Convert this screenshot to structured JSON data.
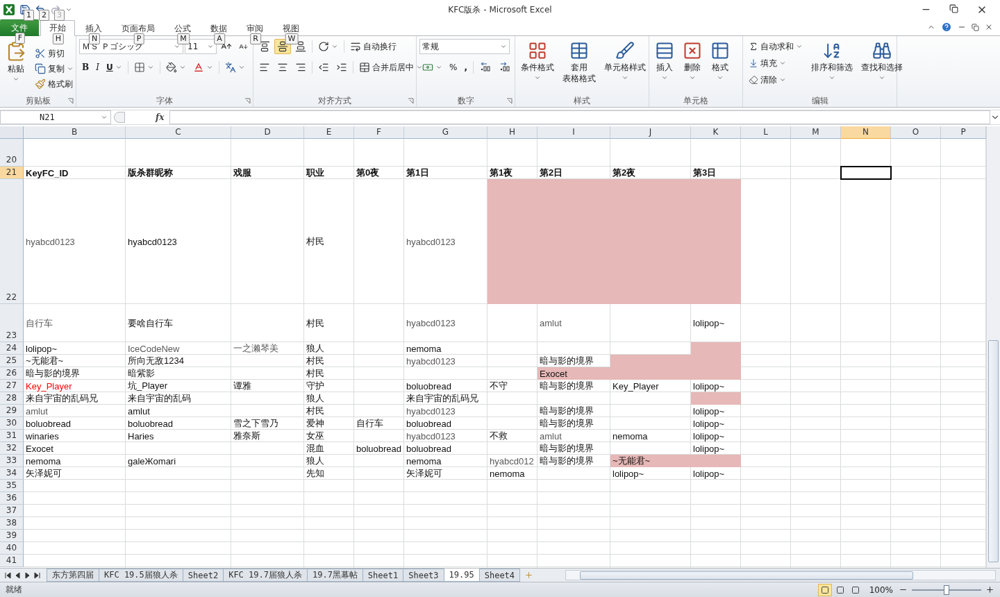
{
  "window": {
    "title": "KFC版杀 - Microsoft Excel"
  },
  "quick_access": [
    {
      "keytip": "1",
      "disabled": false
    },
    {
      "keytip": "2",
      "disabled": false
    },
    {
      "keytip": "3",
      "disabled": true
    }
  ],
  "tabs": [
    {
      "label": "文件",
      "keytip": "F",
      "kind": "file",
      "selected": false
    },
    {
      "label": "开始",
      "keytip": "H",
      "kind": "tab",
      "selected": true
    },
    {
      "label": "插入",
      "keytip": "N",
      "kind": "tab",
      "selected": false
    },
    {
      "label": "页面布局",
      "keytip": "P",
      "kind": "tab",
      "selected": false
    },
    {
      "label": "公式",
      "keytip": "M",
      "kind": "tab",
      "selected": false
    },
    {
      "label": "数据",
      "keytip": "A",
      "kind": "tab",
      "selected": false
    },
    {
      "label": "审阅",
      "keytip": "R",
      "kind": "tab",
      "selected": false
    },
    {
      "label": "视图",
      "keytip": "W",
      "kind": "tab",
      "selected": false
    }
  ],
  "ribbon": {
    "clipboard": {
      "label": "剪贴板",
      "paste": "粘贴",
      "cut": "剪切",
      "copy": "复制",
      "format_painter": "格式刷"
    },
    "font": {
      "label": "字体",
      "font_name": "ＭＳ Ｐゴシック",
      "font_size": "11",
      "bold": "B",
      "italic": "I",
      "underline": "U"
    },
    "alignment": {
      "label": "对齐方式",
      "vertical": [
        {
          "selected": false
        },
        {
          "selected": true
        },
        {
          "selected": false
        }
      ],
      "wrap_text": "自动换行",
      "merge_center": "合并后居中"
    },
    "number": {
      "label": "数字",
      "format": "常规",
      "percent": "%",
      "comma": ","
    },
    "styles": {
      "label": "样式",
      "conditional": "条件格式",
      "table_format": [
        "套用",
        "表格格式"
      ],
      "cell_styles": "单元格样式"
    },
    "cells": {
      "label": "单元格",
      "insert": "插入",
      "delete": "删除",
      "format": "格式"
    },
    "editing": {
      "label": "编辑",
      "autosum": "自动求和",
      "fill": "填充",
      "clear": "清除",
      "sort": "排序和筛选",
      "find": "查找和选择"
    }
  },
  "formula_bar": {
    "name_box": "N21",
    "fx": "fx"
  },
  "columns": [
    {
      "label": "B",
      "selected": false
    },
    {
      "label": "C",
      "selected": false
    },
    {
      "label": "D",
      "selected": false
    },
    {
      "label": "E",
      "selected": false
    },
    {
      "label": "F",
      "selected": false
    },
    {
      "label": "G",
      "selected": false
    },
    {
      "label": "H",
      "selected": false
    },
    {
      "label": "I",
      "selected": false
    },
    {
      "label": "J",
      "selected": false
    },
    {
      "label": "K",
      "selected": false
    },
    {
      "label": "L",
      "selected": false
    },
    {
      "label": "M",
      "selected": false
    },
    {
      "label": "N",
      "selected": true
    },
    {
      "label": "O",
      "selected": false
    },
    {
      "label": "P",
      "selected": false
    }
  ],
  "rows": [
    {
      "label": "20",
      "selected": false,
      "kind": "partial"
    },
    {
      "label": "21",
      "selected": true,
      "kind": "header",
      "cells": [
        {
          "text": "KeyFC_ID"
        },
        {
          "text": "版杀群昵称"
        },
        {
          "text": "戏服"
        },
        {
          "text": "职业"
        },
        {
          "text": "第0夜"
        },
        {
          "text": "第1日"
        },
        {
          "text": "第1夜"
        },
        {
          "text": "第2日"
        },
        {
          "text": "第2夜"
        },
        {
          "text": "第3日"
        }
      ]
    },
    {
      "label": "22",
      "selected": false,
      "kind": "tall",
      "cells": [
        {
          "text": "hyabcd0123",
          "color": "#595959"
        },
        {
          "text": "hyabcd0123"
        },
        null,
        {
          "text": "村民"
        },
        null,
        {
          "text": "hyabcd0123",
          "color": "#595959"
        },
        {
          "fill": true
        },
        {
          "fill": true
        },
        {
          "fill": true
        },
        {
          "fill": true
        }
      ]
    },
    {
      "label": "23",
      "selected": false,
      "kind": "medium",
      "cells": [
        {
          "text": "自行车",
          "color": "#595959"
        },
        {
          "text": "要啥自行车"
        },
        null,
        {
          "text": "村民"
        },
        null,
        {
          "text": "hyabcd0123",
          "color": "#595959"
        },
        null,
        {
          "text": "amlut",
          "color": "#595959"
        },
        null,
        {
          "text": "lolipop~"
        }
      ]
    },
    {
      "label": "24",
      "selected": false,
      "kind": "normal",
      "cells": [
        {
          "text": "lolipop~"
        },
        {
          "text": "IceCodeNew",
          "color": "#595959"
        },
        {
          "text": "一之濑琴美",
          "color": "#595959"
        },
        {
          "text": "狼人"
        },
        null,
        {
          "text": "nemoma"
        },
        null,
        null,
        null,
        {
          "fill": true
        }
      ]
    },
    {
      "label": "25",
      "selected": false,
      "kind": "normal",
      "cells": [
        {
          "text": "~无能君~"
        },
        {
          "text": "所向无敌1234"
        },
        null,
        {
          "text": "村民"
        },
        null,
        {
          "text": "hyabcd0123",
          "color": "#595959"
        },
        null,
        {
          "text": "暗与影的境界"
        },
        {
          "fill": true
        },
        {
          "fill": true
        }
      ]
    },
    {
      "label": "26",
      "selected": false,
      "kind": "normal",
      "cells": [
        {
          "text": "暗与影的境界"
        },
        {
          "text": "暗紫影"
        },
        null,
        {
          "text": "村民"
        },
        null,
        null,
        null,
        {
          "text": "Exocet",
          "fill": true
        },
        {
          "fill": true
        },
        {
          "fill": true
        }
      ]
    },
    {
      "label": "27",
      "selected": false,
      "kind": "normal",
      "cells": [
        {
          "text": "Key_Player",
          "color": "#ff0000"
        },
        {
          "text": "坑_Player"
        },
        {
          "text": "谭雅"
        },
        {
          "text": "守护"
        },
        null,
        {
          "text": "boluobread"
        },
        {
          "text": "不守"
        },
        {
          "text": "暗与影的境界"
        },
        {
          "text": "Key_Player"
        },
        {
          "text": "lolipop~"
        }
      ]
    },
    {
      "label": "28",
      "selected": false,
      "kind": "normal",
      "cells": [
        {
          "text": "来自宇宙的乱码兄"
        },
        {
          "text": "来自宇宙的乱码"
        },
        null,
        {
          "text": "狼人"
        },
        null,
        {
          "text": "来自宇宙的乱码兄"
        },
        null,
        null,
        null,
        {
          "fill": true
        }
      ]
    },
    {
      "label": "29",
      "selected": false,
      "kind": "normal",
      "cells": [
        {
          "text": "amlut",
          "color": "#595959"
        },
        {
          "text": "amlut"
        },
        null,
        {
          "text": "村民"
        },
        null,
        {
          "text": "hyabcd0123",
          "color": "#595959"
        },
        null,
        {
          "text": "暗与影的境界"
        },
        null,
        {
          "text": "lolipop~"
        }
      ]
    },
    {
      "label": "30",
      "selected": false,
      "kind": "normal",
      "cells": [
        {
          "text": "boluobread"
        },
        {
          "text": "boluobread"
        },
        {
          "text": "雪之下雪乃"
        },
        {
          "text": "爱神"
        },
        {
          "text": "自行车"
        },
        {
          "text": "boluobread"
        },
        null,
        {
          "text": "暗与影的境界"
        },
        null,
        {
          "text": "lolipop~"
        }
      ]
    },
    {
      "label": "31",
      "selected": false,
      "kind": "normal",
      "cells": [
        {
          "text": "winaries"
        },
        {
          "text": "Haries"
        },
        {
          "text": "雅奈斯"
        },
        {
          "text": "女巫"
        },
        null,
        {
          "text": "hyabcd0123",
          "color": "#595959"
        },
        {
          "text": "不救"
        },
        {
          "text": "amlut",
          "color": "#595959"
        },
        {
          "text": "nemoma"
        },
        {
          "text": "lolipop~"
        }
      ]
    },
    {
      "label": "32",
      "selected": false,
      "kind": "normal",
      "cells": [
        {
          "text": "Exocet"
        },
        null,
        null,
        {
          "text": "混血"
        },
        {
          "text": "boluobread"
        },
        {
          "text": "boluobread"
        },
        null,
        {
          "text": "暗与影的境界"
        },
        null,
        {
          "text": "lolipop~"
        }
      ]
    },
    {
      "label": "33",
      "selected": false,
      "kind": "normal",
      "cells": [
        {
          "text": "nemoma"
        },
        {
          "text": "galeЖomari"
        },
        null,
        {
          "text": "狼人"
        },
        null,
        {
          "text": "nemoma"
        },
        {
          "text": "hyabcd012",
          "color": "#595959"
        },
        {
          "text": "暗与影的境界"
        },
        {
          "text": "~无能君~",
          "fill": true
        },
        {
          "fill": true
        }
      ]
    },
    {
      "label": "34",
      "selected": false,
      "kind": "normal",
      "cells": [
        {
          "text": "矢泽妮可"
        },
        null,
        null,
        {
          "text": "先知"
        },
        null,
        {
          "text": "矢泽妮可"
        },
        {
          "text": "nemoma"
        },
        null,
        {
          "text": "lolipop~"
        },
        {
          "text": "lolipop~"
        }
      ]
    },
    {
      "label": "35",
      "selected": false,
      "kind": "normal"
    },
    {
      "label": "36",
      "selected": false,
      "kind": "normal"
    },
    {
      "label": "37",
      "selected": false,
      "kind": "normal"
    },
    {
      "label": "38",
      "selected": false,
      "kind": "normal"
    },
    {
      "label": "39",
      "selected": false,
      "kind": "normal"
    },
    {
      "label": "40",
      "selected": false,
      "kind": "normal"
    },
    {
      "label": "41",
      "selected": false,
      "kind": "normal"
    }
  ],
  "sheets": [
    {
      "label": "东方第四届",
      "selected": false
    },
    {
      "label": "KFC 19.5届狼人杀",
      "selected": false
    },
    {
      "label": "Sheet2",
      "selected": false
    },
    {
      "label": "KFC 19.7届狼人杀",
      "selected": false
    },
    {
      "label": "19.7黑幕帖",
      "selected": false
    },
    {
      "label": "Sheet1",
      "selected": false
    },
    {
      "label": "Sheet3",
      "selected": false
    },
    {
      "label": "19.95",
      "selected": true
    },
    {
      "label": "Sheet4",
      "selected": false
    }
  ],
  "status_bar": {
    "status": "就绪",
    "views": [
      {
        "selected": true
      },
      {
        "selected": false
      },
      {
        "selected": false
      }
    ],
    "zoom": "100%",
    "zoom_slider": {
      "level": 0.5
    }
  }
}
